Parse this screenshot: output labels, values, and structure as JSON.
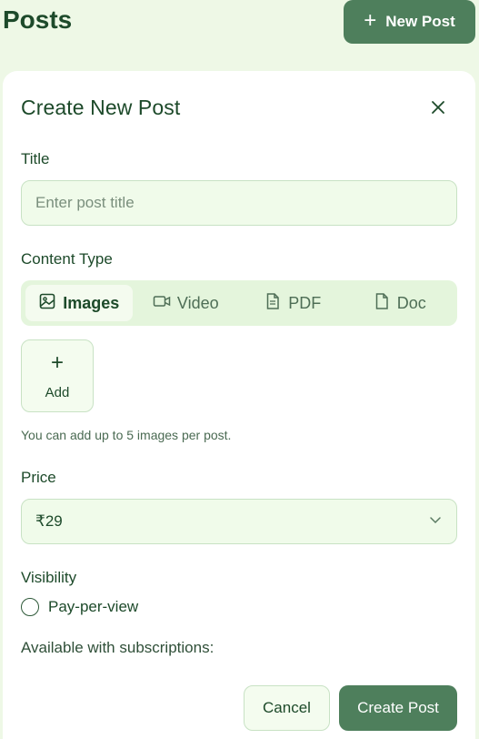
{
  "header": {
    "title": "Posts",
    "new_post_label": "New Post"
  },
  "modal": {
    "title": "Create New Post",
    "title_field": {
      "label": "Title",
      "placeholder": "Enter post title",
      "value": ""
    },
    "content_type": {
      "label": "Content Type",
      "tabs": [
        {
          "label": "Images",
          "icon": "image-icon",
          "active": true
        },
        {
          "label": "Video",
          "icon": "video-icon",
          "active": false
        },
        {
          "label": "PDF",
          "icon": "pdf-file-icon",
          "active": false
        },
        {
          "label": "Doc",
          "icon": "doc-file-icon",
          "active": false
        }
      ]
    },
    "add_tile_label": "Add",
    "hint": "You can add up to 5 images per post.",
    "price": {
      "label": "Price",
      "value": "₹29"
    },
    "visibility": {
      "label": "Visibility",
      "option_label": "Pay-per-view",
      "selected": false
    },
    "available_text": "Available with subscriptions:",
    "cancel_label": "Cancel",
    "create_label": "Create Post"
  },
  "colors": {
    "primary": "#4e7f5c",
    "background": "#eef8e6",
    "text": "#1d4a2a"
  }
}
